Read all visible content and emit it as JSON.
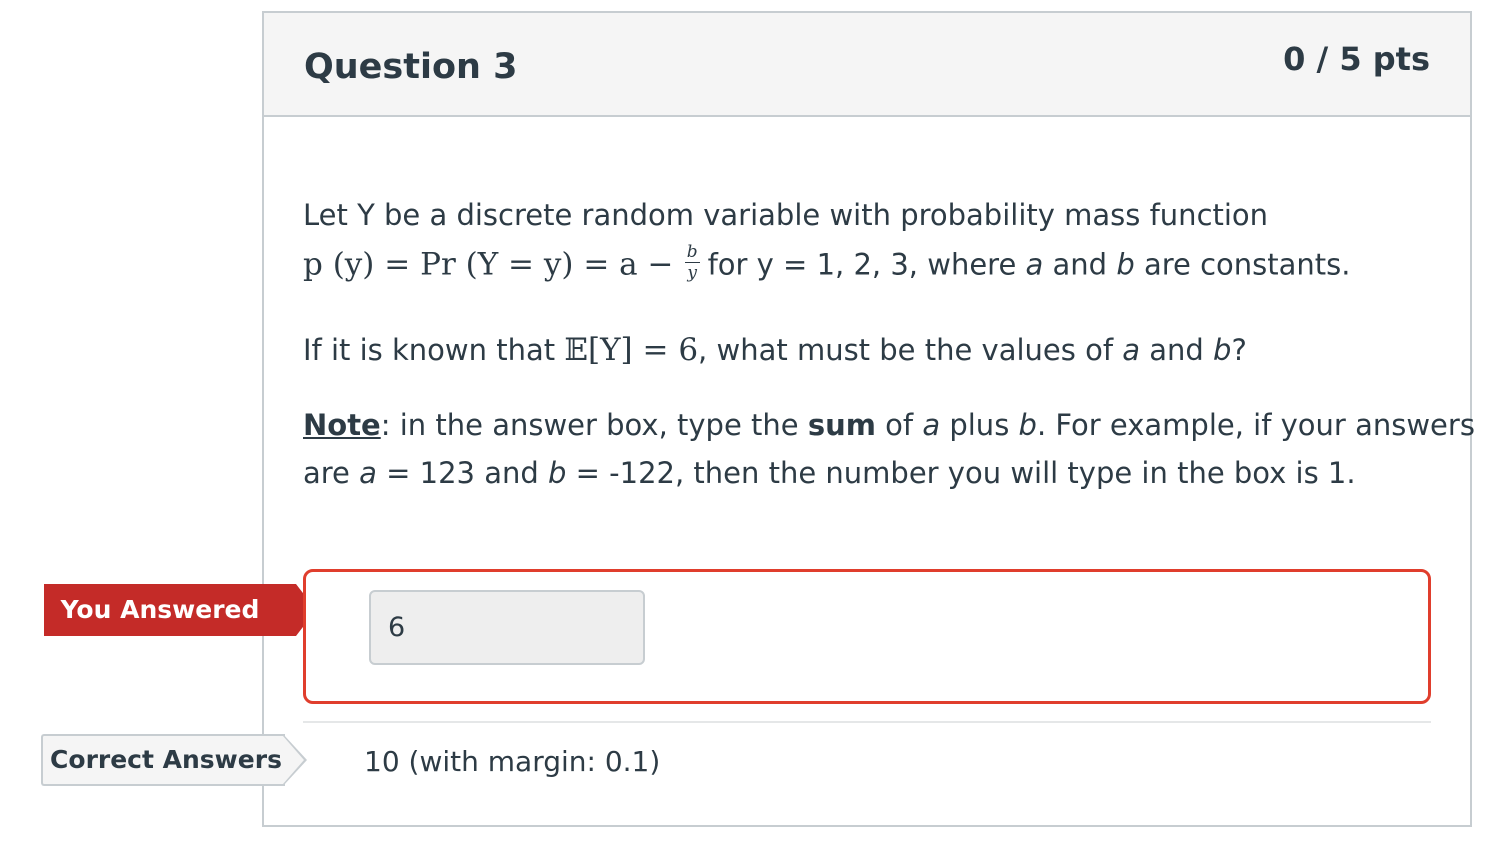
{
  "question": {
    "title": "Question 3",
    "points": "0 / 5 pts"
  },
  "body": {
    "line1": "Let Y be a discrete random variable with probability mass function",
    "line2_math": "p (y) = Pr (Y = y) = a −",
    "line2_frac_num": "b",
    "line2_frac_den": "y",
    "line2_for": "for y = 1, 2, 3, where ",
    "var_a": "a",
    "and_text": " and ",
    "var_b": "b",
    "line2_end": " are constants.",
    "line3_start": "If it is known that ",
    "line3_math": "𝔼[Y] = 6",
    "line3_mid": ", what must be the values of ",
    "line3_end": "?",
    "note_label": "Note",
    "note_colon": ": in the answer box, type the ",
    "note_sum": "sum",
    "note_of": " of ",
    "note_plus": " plus ",
    "note_example": ". For example, if your answers",
    "line5_are": "are ",
    "line5_eq1": " = 123 and ",
    "line5_eq2": " = -122, then the number you will type in the box is 1."
  },
  "you_answered": {
    "label": "You Answered",
    "value": "6"
  },
  "correct_answers": {
    "label": "Correct Answers",
    "value": "10 (with margin: 0.1)"
  },
  "colors": {
    "incorrect_red": "#c42b28",
    "answer_border": "#e03e2d",
    "header_bg": "#f5f5f5",
    "text": "#2d3b45"
  }
}
